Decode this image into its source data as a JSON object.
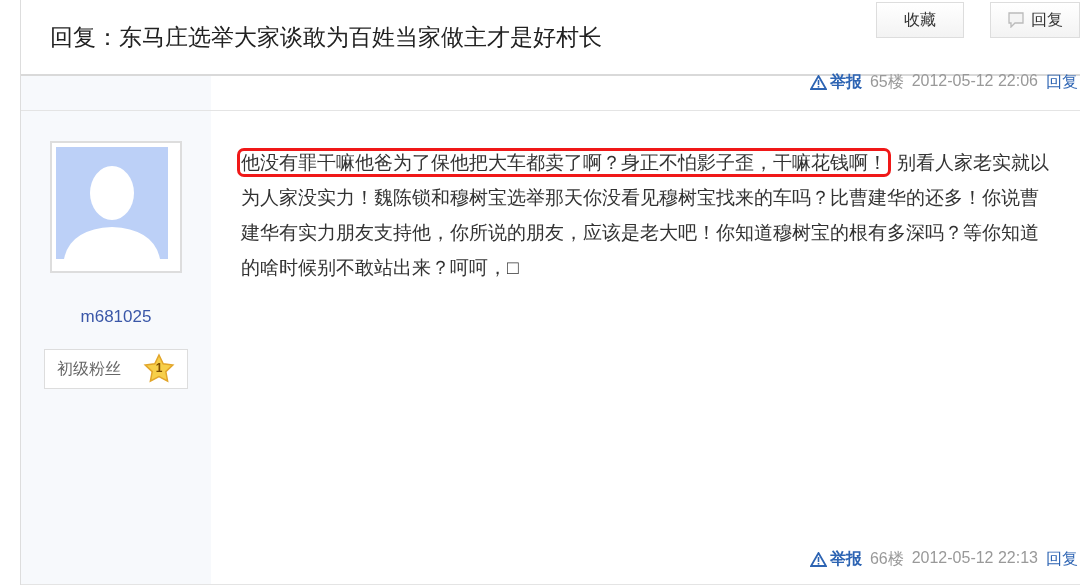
{
  "header": {
    "title": "回复：东马庄选举大家谈敢为百姓当家做主才是好村长",
    "buttons": [
      {
        "label": "收藏",
        "kind": "plain"
      },
      {
        "label": "回复",
        "kind": "reply"
      }
    ]
  },
  "floors": [
    {
      "report": "举报",
      "floor": "65楼",
      "time": "2012-05-12 22:06",
      "reply": "回复"
    }
  ],
  "post": {
    "username": "m681025",
    "badge": {
      "label": "初级粉丝",
      "level_number": "1"
    },
    "body": [
      {
        "text": "他没有罪干嘛他爸为了保他把大车都卖了啊？身正不怕影子歪，干嘛花钱啊！",
        "highlighted": true
      },
      {
        "text": "别看人家老实就以为人家没实力！魏陈锁和穆树宝选举那天你没看见穆树宝找来的车吗？比曹建华的还多！你说曹建华有实力朋友支持他，你所说的朋友，应该是老大吧！你知道穆树宝的根有多深吗？等你知道的啥时候别不敢站出来？呵呵，□",
        "highlighted": false
      }
    ],
    "footer": {
      "report": "举报",
      "floor": "66楼",
      "time": "2012-05-12 22:13",
      "reply": "回复"
    }
  }
}
